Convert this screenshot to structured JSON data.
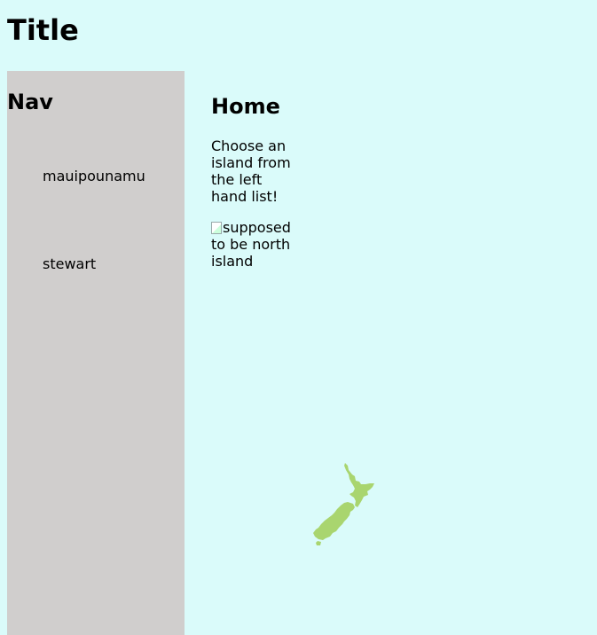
{
  "page": {
    "title": "Title"
  },
  "nav": {
    "heading": "Nav",
    "items": [
      {
        "label": "mauipounamu"
      },
      {
        "label": "stewart"
      }
    ]
  },
  "main": {
    "heading": "Home",
    "intro": "Choose an island from the left hand list!",
    "image_alt": "supposed to be north island"
  },
  "colors": {
    "background": "#dafbfa",
    "nav_background": "#d0cecd",
    "map_fill": "#a9d56f"
  },
  "icons": {
    "map": "new-zealand-map-icon",
    "broken_image": "broken-image-icon"
  }
}
